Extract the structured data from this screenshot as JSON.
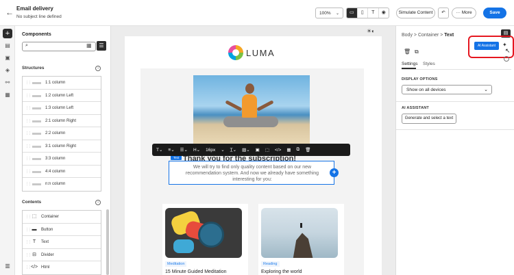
{
  "header": {
    "title": "Email delivery",
    "subtitle": "No subject line defined",
    "zoom": "100%",
    "simulate_label": "Simulate Content",
    "more_label": "More",
    "save_label": "Save"
  },
  "components": {
    "title": "Components",
    "search_placeholder": "",
    "structures_label": "Structures",
    "structures": [
      {
        "label": "1:1 column"
      },
      {
        "label": "1:2 column Left"
      },
      {
        "label": "1:3 column Left"
      },
      {
        "label": "2:1 column Right"
      },
      {
        "label": "2:2 column"
      },
      {
        "label": "3:1 column Right"
      },
      {
        "label": "3:3 column"
      },
      {
        "label": "4:4 column"
      },
      {
        "label": "n:n column"
      }
    ],
    "contents_label": "Contents",
    "contents": [
      {
        "label": "Container",
        "icon": "container-icon"
      },
      {
        "label": "Button",
        "icon": "button-icon"
      },
      {
        "label": "Text",
        "icon": "text-icon"
      },
      {
        "label": "Divider",
        "icon": "divider-icon"
      },
      {
        "label": "Html",
        "icon": "html-icon"
      }
    ]
  },
  "canvas": {
    "logo_text": "LUMA",
    "heading": "Thank you for the subscription!",
    "selected_tag": "Text",
    "selected_text": "We will try to find only quality content based on our new recommendation system. And now we already have something interesting for you:",
    "toolbar": {
      "font_size": "16px"
    },
    "cards": [
      {
        "tag": "Meditation",
        "title": "15 Minute Guided Meditation"
      },
      {
        "tag": "Reading",
        "title": "Exploring the world"
      }
    ]
  },
  "right_panel": {
    "breadcrumb": {
      "body": "Body",
      "container": "Container",
      "current": "Text"
    },
    "ai_assistant_label": "AI Assistant",
    "tabs": [
      {
        "label": "Settings"
      },
      {
        "label": "Styles"
      }
    ],
    "display_options_label": "DISPLAY OPTIONS",
    "display_value": "Show on all devices",
    "ai_section_label": "AI ASSISTANT",
    "generate_label": "Generate and select a text"
  },
  "colors": {
    "accent": "#1473e6",
    "highlight": "#e5161f"
  }
}
